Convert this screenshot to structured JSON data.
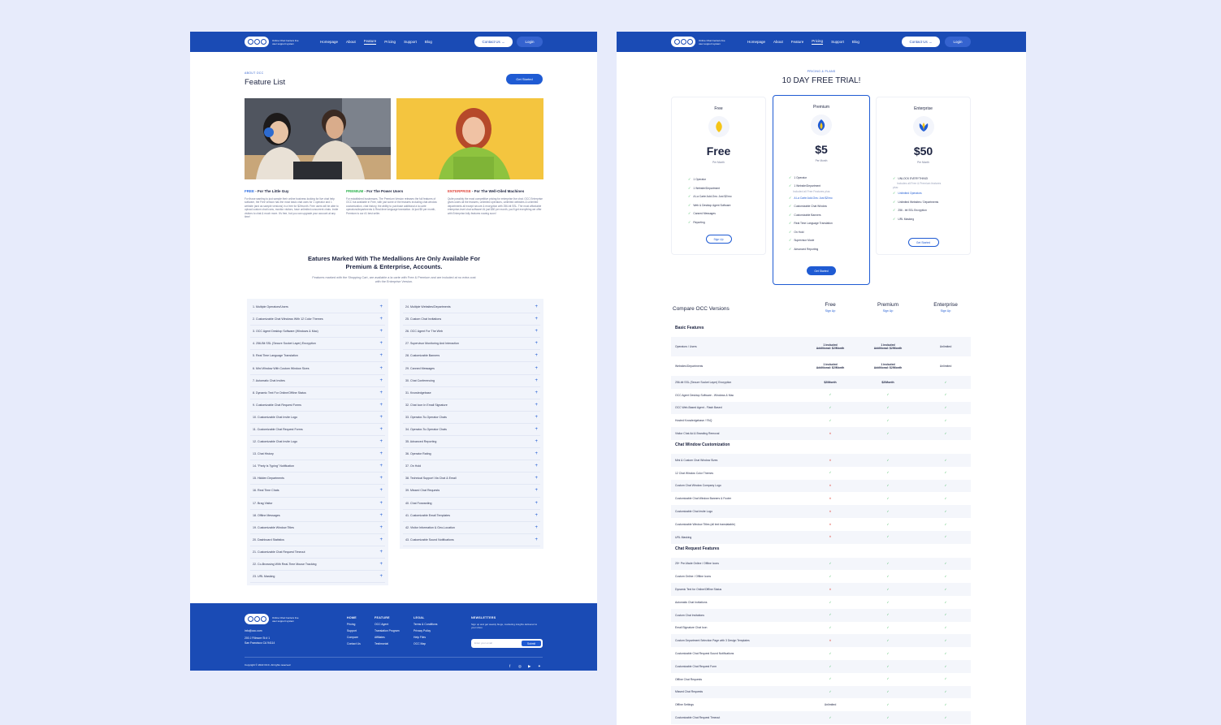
{
  "nav": {
    "logo_text": "Online Chat Centers live user support system",
    "items": [
      "Homepage",
      "About",
      "Feature",
      "Pricing",
      "Support",
      "Blog"
    ],
    "contact": "Contact Us →",
    "login": "Login"
  },
  "feature_page": {
    "eyebrow": "ABOUT OCC",
    "title": "Feature List",
    "cta": "Get Started",
    "plans": [
      {
        "tag": "FREE",
        "tag_color": "#2f6fe4",
        "title": " - For The Little Guy",
        "desc": "For those wanting to just sample their online business looking for live chat help software, the Free version has the most basic chat uses for 1 operator and 1 website (and as sample versions) in a free for $2/month. Free users will be able to upload custom chat icons, monitor visitors, have unlimited concurrent chats. Invite visitors to chat & much more. It's free, but you can upgrade your account at any time!"
      },
      {
        "tag": "PREMIUM",
        "tag_color": "#2bb24c",
        "title": " - For The Power Users",
        "desc": "For established businesses, The Premium Version releases the full features of OCC but available in Free, with just some of the features including chat window customization, chat history, the ability to purchase additional a la carte operators/departments & Real-time language translation. At just $5 per month, Premium is our #1 best seller."
      },
      {
        "tag": "ENTERPRISE",
        "tag_color": "#e0463c",
        "title": " - For The Well-Oiled Machines",
        "desc": "Quite possibly the most competitive pricing for enterprise live chat. OCC Enterprise gives users all the features, unlimited operators, unlimited websites & unlimited departments all except secure & encryption with 256-bit SSL. The most affordable enterprise-level chat software! At just $50 per month, you'll get everything we offer with Enterprise-fully features roaring soon!"
      }
    ],
    "section_title": "Eatures Marked With The Medallions Are Only Available For Premium & Enterprise, Accounts.",
    "section_sub": "Features marked with the Shopping Cart, are available a la carte with Free & Premium and are included at no extra cost with the Enterprise Version.",
    "features_left": [
      "1. Multiple Operators/Users",
      "2. Customizable Chat Windows With 12 Color Themes",
      "3. OCC Agent Desktop Software (Windows & Mac)",
      "4. 256-Bit SSL (Secure Socket Layer) Encryption",
      "5. Real Time Language Translation",
      "6. Mini Window With Custom Window Sizes",
      "7. Automatic Chat Invites",
      "8. Dynamic Text For Online/Offline Status",
      "9. Customizable Chat Request Forms",
      "10. Customizable Chat Invite Logo",
      "11. Customizable Chat Request Forms",
      "12. Customizable Chat Invite Logo",
      "13. Chat History",
      "14. \"Party Is Typing\" Notification",
      "15. Hidden Departments",
      "16. Real Time Chats",
      "17. Brag Visitor",
      "18. Offline Messages",
      "19. Customizable Window Titles",
      "20. Dashboard Statistics",
      "21. Customizable Chat Request Timeout",
      "22. Co-Browsing With Real-Time Mouse Tracking",
      "23. URL Masking"
    ],
    "features_right": [
      "24. Multiple Websites/Departments",
      "25. Custom Chat Invitations",
      "26. OCC Agent For The Web",
      "27. Supervisor Monitoring And Interaction",
      "28. Customizable Banners",
      "29. Canned Messages",
      "30. Chat Conferencing",
      "31. Knowledgebase",
      "32. Chat Icon In Email Signature",
      "33. Operator-To-Operator Chats",
      "34. Operator-To-Operator Chats",
      "35. Advanced Reporting",
      "36. Operator Rating",
      "37. On Hold",
      "38. Technical Support Via Chat & Email",
      "39. Missed Chat Requests",
      "40. Chat Forwarding",
      "41. Customizable Email Templates",
      "42. Visitor Information & Geo-Location",
      "43. Customizable Sound Notifications"
    ],
    "plus": "+"
  },
  "footer": {
    "email": "info@occ.com",
    "address1": "200 J Fillmore St # 1",
    "address2": "San Francisco CA 94114",
    "col1_head": "HOME",
    "col1": [
      "Pricing",
      "Support",
      "Compare",
      "Contact Us"
    ],
    "col2_head": "FEATURE",
    "col2": [
      "OCC Agent",
      "Translation Program",
      "Affiliates",
      "Testimonial"
    ],
    "col3_head": "LEGAL",
    "col3": [
      "Terms & Conditions",
      "Privacy Policy",
      "Help Files",
      "OCC Map"
    ],
    "newsletter_head": "NEWSLETTERS",
    "newsletter_text": "Sign up and get weekly blogs, marketing insights delivered to your inbox",
    "placeholder": "Enter your email",
    "submit": "Submit",
    "copyright": "Copyright © 2022 OCC. All rights reserved",
    "social": [
      "f",
      "◎",
      "▶",
      "✦"
    ]
  },
  "pricing_page": {
    "eyebrow": "PRICING & PLANS",
    "title": "10 DAY FREE TRIAL!",
    "plans": [
      {
        "name": "Free",
        "price": "Free",
        "per": "Per Month",
        "btn": "Sign Up",
        "icon_color": "#f5c518",
        "features": [
          "1 Operator",
          "1 Website/Department",
          "A La Carte Add-Ons: Just $2/mo",
          "Web & Desktop Agent Software",
          "Canned Messages",
          "Reporting"
        ]
      },
      {
        "name": "Premium",
        "price": "$5",
        "per": "Per Month",
        "btn": "Get Started",
        "icon_color": "#1f5bd3",
        "features": [
          "1 Operator",
          "1 Website/Department",
          "Included all Free Features plus:",
          "A La Carte Add-Ons: Just $2/mo",
          "Customizable Chat Window",
          "Customizable Banners",
          "Real Time Language Translation",
          "On Hold",
          "Supervisor Mode",
          "Advanced Reporting"
        ]
      },
      {
        "name": "Enterprise",
        "price": "$50",
        "per": "Per Month",
        "btn": "Get Started",
        "icon_color": "#2bb24c",
        "features": [
          "UNLOCK EVERYTHING!",
          "Includes all Free & Premium features plus:",
          "Unlimited Operators",
          "Unlimited Websites / Departments",
          "256 - bit SSL Encryption",
          "URL Masking"
        ]
      }
    ],
    "compare_title": "Compare OCC Versions",
    "columns": [
      {
        "name": "Free",
        "link": "Sign Up"
      },
      {
        "name": "Premium",
        "link": "Sign Up"
      },
      {
        "name": "Enterprise",
        "link": "Sign Up"
      }
    ],
    "sections": [
      {
        "title": "Basic Features",
        "rows": [
          {
            "label": "Operators / Users",
            "vals": [
              "1 included\nAdditional: $2/Month",
              "1 included\nAdditional: $2/Month",
              "Unlimited"
            ]
          },
          {
            "label": "Websites/Departments",
            "vals": [
              "1 included\nAdditional: $2/Month",
              "1 included\nAdditional: $2/Month",
              "Unlimited"
            ]
          },
          {
            "label": "256-bit SSL (Secure Socket Layer) Encryption",
            "vals": [
              "$2/Month",
              "$2/Month",
              "✓"
            ]
          },
          {
            "label": "OCC Agent Desktop Software - Windows & Mac",
            "vals": [
              "✓",
              "✓",
              "✓"
            ]
          },
          {
            "label": "OCC Web-Based Agent - Flash Based",
            "vals": [
              "✓",
              "✓",
              "✓"
            ]
          },
          {
            "label": "Hosted Knowledgebase / FAQ",
            "vals": [
              "✓",
              "✓",
              "✓"
            ]
          },
          {
            "label": "Visitor Chat Ad & Branding Removal",
            "vals": [
              "✕",
              "✓",
              "✓"
            ]
          }
        ]
      },
      {
        "title": "Chat Window Customization",
        "rows": [
          {
            "label": "Mini & Custom Chat Window Sizes",
            "vals": [
              "✕",
              "✓",
              "✓"
            ]
          },
          {
            "label": "12 Chat Window Color Themes",
            "vals": [
              "✓",
              "✓",
              "✓"
            ]
          },
          {
            "label": "Custom Chat Window Company Logo",
            "vals": [
              "✕",
              "✓",
              "✓"
            ]
          },
          {
            "label": "Customizable Chat Window Banners & Footer",
            "vals": [
              "✕",
              "✓",
              "✓"
            ]
          },
          {
            "label": "Customizable Chat Invite Logo",
            "vals": [
              "✕",
              "✓",
              "✓"
            ]
          },
          {
            "label": "Customizable Window Titles (all text translatable)",
            "vals": [
              "✕",
              "✓",
              "✓"
            ]
          },
          {
            "label": "URL Masking",
            "vals": [
              "✕",
              "✓",
              "✓"
            ]
          }
        ]
      },
      {
        "title": "Chat Request Features",
        "rows": [
          {
            "label": "25+ Pre-Made Online / Offline Icons",
            "vals": [
              "✓",
              "✓",
              "✓"
            ]
          },
          {
            "label": "Custom Online / Offline Icons",
            "vals": [
              "✓",
              "✓",
              "✓"
            ]
          },
          {
            "label": "Dynamic Text for Online/Offline Status",
            "vals": [
              "✕",
              "✓",
              "✓"
            ]
          },
          {
            "label": "Automatic Chat Invitations",
            "vals": [
              "✓",
              "✓",
              "✓"
            ]
          },
          {
            "label": "Custom Chat Invitations",
            "vals": [
              "✓",
              "✓",
              "✓"
            ]
          },
          {
            "label": "Email Signature Chat Icon",
            "vals": [
              "✓",
              "✓",
              "✓"
            ]
          },
          {
            "label": "Custom Department Selection Page with 3 Design Templates",
            "vals": [
              "✕",
              "✓",
              "✓"
            ]
          },
          {
            "label": "Customizable Chat Request Sound Notifications",
            "vals": [
              "✓",
              "✓",
              "✓"
            ]
          },
          {
            "label": "Customizable Chat Request Form",
            "vals": [
              "✓",
              "✓",
              "✓"
            ]
          },
          {
            "label": "Offline Chat Requests",
            "vals": [
              "✓",
              "✓",
              "✓"
            ]
          },
          {
            "label": "Missed Chat Requests",
            "vals": [
              "✓",
              "✓",
              "✓"
            ]
          },
          {
            "label": "Offline Settings",
            "vals": [
              "Unlimited",
              "✓",
              "✓"
            ]
          },
          {
            "label": "Customizable Chat Request Timeout",
            "vals": [
              "✓",
              "✓",
              "✓"
            ]
          }
        ]
      }
    ]
  }
}
